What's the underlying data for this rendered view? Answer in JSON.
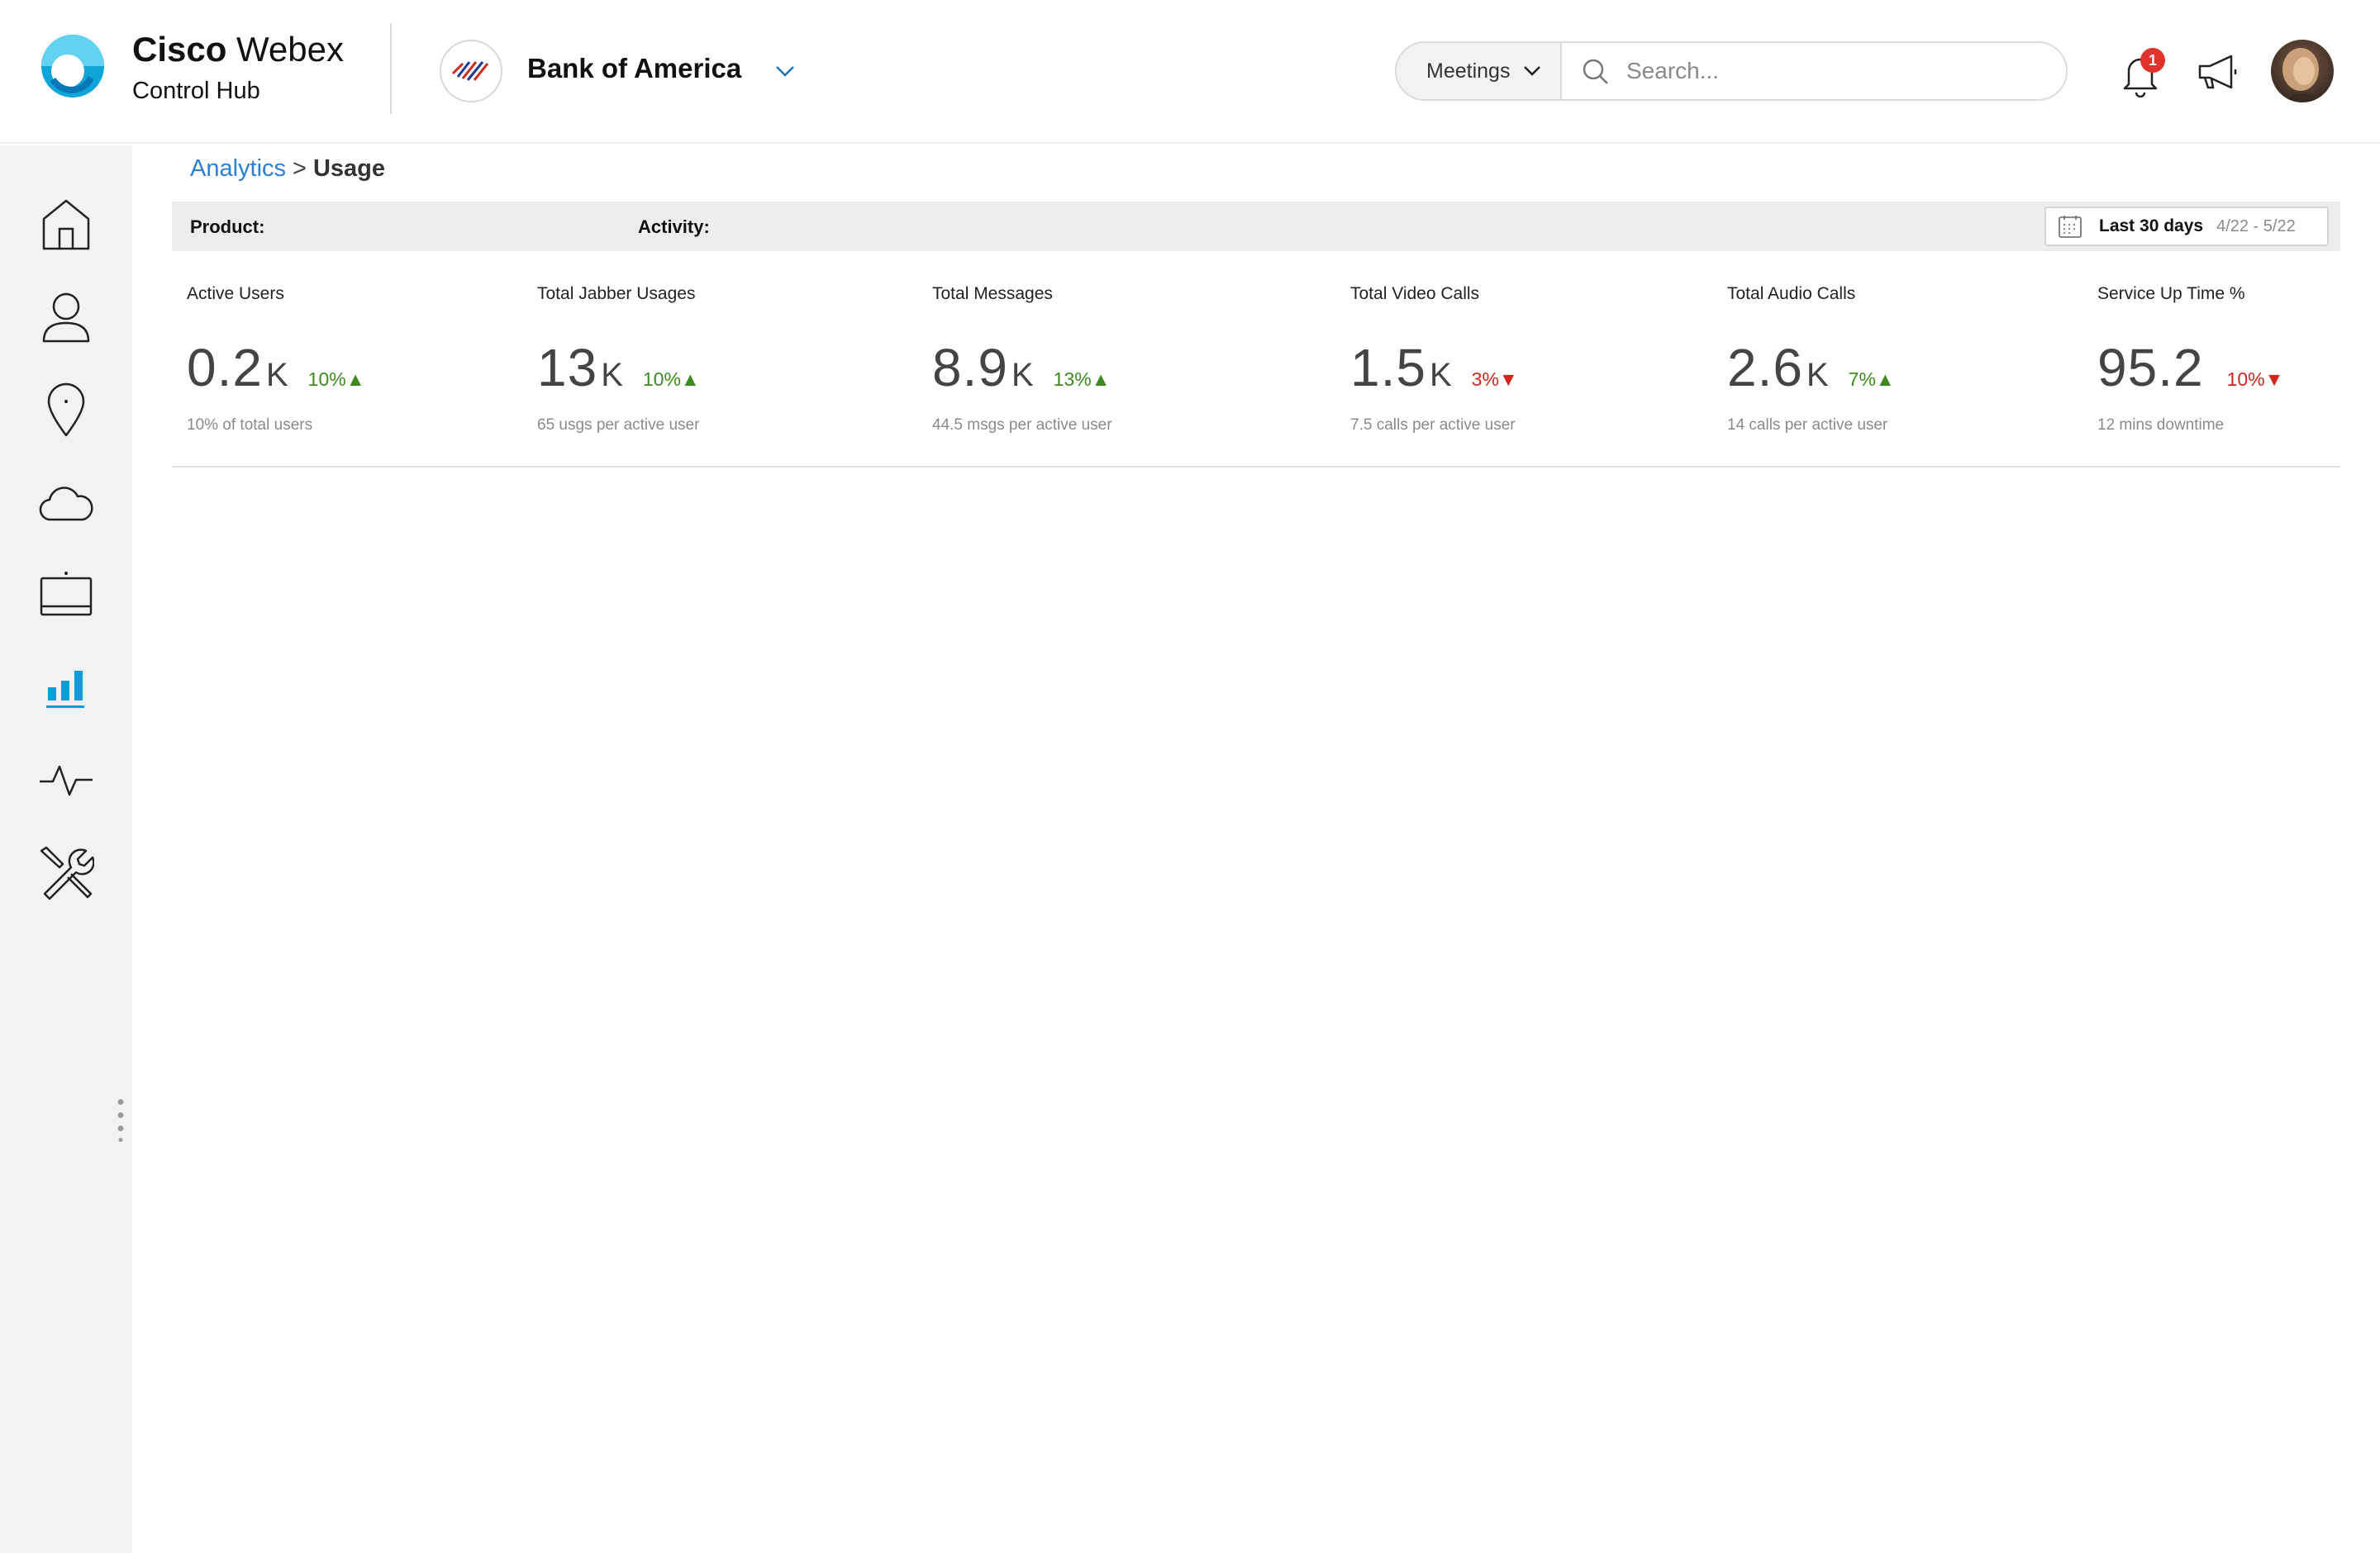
{
  "app": {
    "brand_bold": "Cisco",
    "brand_light": "Webex",
    "subtitle": "Control Hub"
  },
  "org": {
    "name": "Bank of America"
  },
  "search": {
    "scope": "Meetings",
    "placeholder": "Search..."
  },
  "notifications": {
    "count": "1"
  },
  "sidebar": {
    "items": [
      {
        "name": "home",
        "icon": "home-icon"
      },
      {
        "name": "users",
        "icon": "user-icon"
      },
      {
        "name": "locations",
        "icon": "location-pin-icon"
      },
      {
        "name": "services",
        "icon": "cloud-icon"
      },
      {
        "name": "devices",
        "icon": "device-icon"
      },
      {
        "name": "analytics",
        "icon": "bar-chart-icon",
        "active": true
      },
      {
        "name": "troubleshooting",
        "icon": "pulse-icon"
      },
      {
        "name": "management",
        "icon": "tools-icon"
      }
    ]
  },
  "breadcrumb": {
    "parent": "Analytics",
    "separator": ">",
    "current": "Usage"
  },
  "filters": {
    "product_label": "Product:",
    "activity_label": "Activity:",
    "date_label": "Last 30 days",
    "date_range": "4/22 - 5/22"
  },
  "metrics": [
    {
      "title": "Active Users",
      "value": "0.2",
      "unit": "K",
      "change": "10%",
      "direction": "up",
      "sub": "10% of total users"
    },
    {
      "title": "Total Jabber Usages",
      "value": "13",
      "unit": "K",
      "change": "10%",
      "direction": "up",
      "sub": "65 usgs per active user"
    },
    {
      "title": "Total Messages",
      "value": "8.9",
      "unit": "K",
      "change": "13%",
      "direction": "up",
      "sub": "44.5 msgs per active user"
    },
    {
      "title": "Total Video Calls",
      "value": "1.5",
      "unit": "K",
      "change": "3%",
      "direction": "down",
      "sub": "7.5 calls per active user"
    },
    {
      "title": "Total Audio Calls",
      "value": "2.6",
      "unit": "K",
      "change": "7%",
      "direction": "up",
      "sub": "14 calls per active user"
    },
    {
      "title": "Service Up Time %",
      "value": "95.2",
      "unit": "",
      "change": "10%",
      "direction": "down",
      "sub": "12 mins downtime"
    }
  ],
  "colors": {
    "accent": "#049fd9",
    "link": "#2d7fd4",
    "up": "#3d8a1e",
    "down": "#d0271d",
    "badge": "#e0332b",
    "sidebar_bg": "#f2f2f2"
  }
}
